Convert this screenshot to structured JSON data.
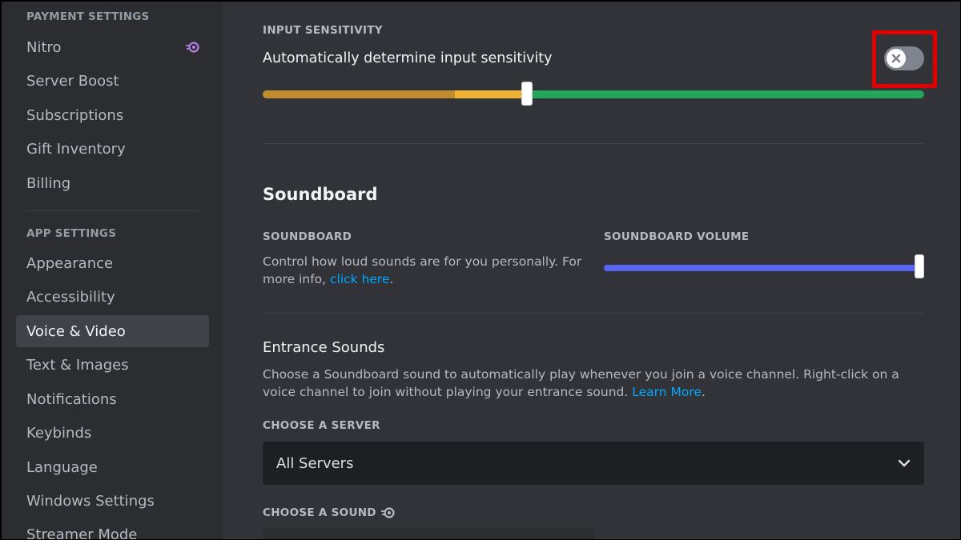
{
  "sidebar": {
    "payment_header": "PAYMENT SETTINGS",
    "payment_items": [
      {
        "label": "Nitro"
      },
      {
        "label": "Server Boost"
      },
      {
        "label": "Subscriptions"
      },
      {
        "label": "Gift Inventory"
      },
      {
        "label": "Billing"
      }
    ],
    "app_header": "APP SETTINGS",
    "app_items": [
      {
        "label": "Appearance"
      },
      {
        "label": "Accessibility"
      },
      {
        "label": "Voice & Video",
        "active": true
      },
      {
        "label": "Text & Images"
      },
      {
        "label": "Notifications"
      },
      {
        "label": "Keybinds"
      },
      {
        "label": "Language"
      },
      {
        "label": "Windows Settings"
      },
      {
        "label": "Streamer Mode"
      }
    ]
  },
  "input_sensitivity": {
    "label": "INPUT SENSITIVITY",
    "auto_label": "Automatically determine input sensitivity",
    "auto_enabled": false,
    "slider_value_fraction": 0.4,
    "meter_level_fraction": 0.29
  },
  "soundboard": {
    "title": "Soundboard",
    "label": "SOUNDBOARD",
    "description": "Control how loud sounds are for you personally. For more info, ",
    "link_text": "click here",
    "description_end": ".",
    "volume_label": "SOUNDBOARD VOLUME",
    "volume_fraction": 1.0
  },
  "entrance_sounds": {
    "title": "Entrance Sounds",
    "description": "Choose a Soundboard sound to automatically play whenever you join a voice channel. Right-click on a voice channel to join without playing your entrance sound. ",
    "link_text": "Learn More",
    "description_end": ".",
    "server_label": "CHOOSE A SERVER",
    "server_value": "All Servers",
    "sound_label": "CHOOSE A SOUND"
  },
  "colors": {
    "accent": "#5865f2",
    "link": "#00a8fc",
    "highlight": "#e50000",
    "meter_green": "#23a55a",
    "meter_yellow": "#f0b232"
  }
}
